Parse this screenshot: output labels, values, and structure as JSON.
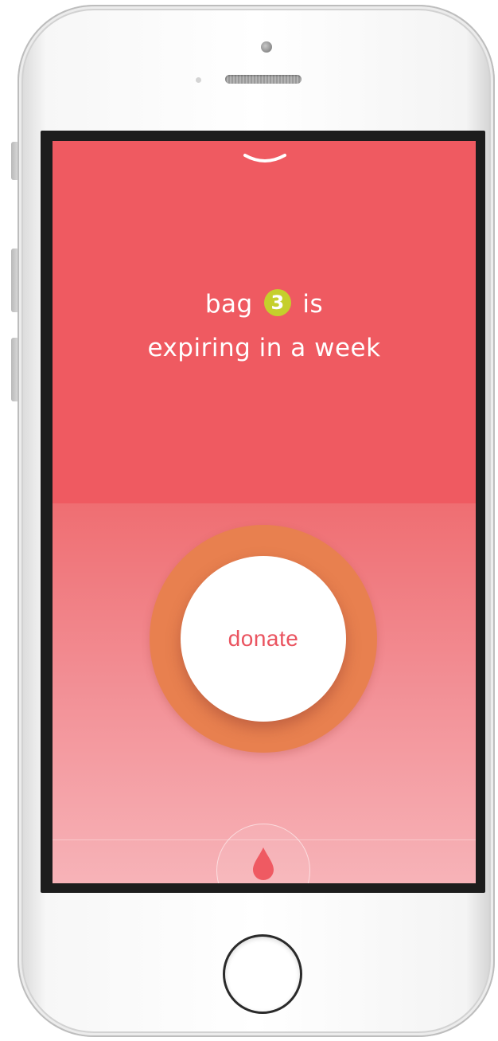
{
  "message": {
    "prefix": "bag",
    "bag_number": "3",
    "suffix": "is",
    "line2": "expiring in a week"
  },
  "action": {
    "donate_label": "donate"
  },
  "icons": {
    "collapse": "chevron-down-icon",
    "tab": "blood-drop-icon"
  },
  "colors": {
    "top_panel": "#ef5a61",
    "bottom_gradient_start": "#ef6e72",
    "bottom_gradient_end": "#f7b3b8",
    "badge": "#c5cf2c",
    "ring": "#e8804f",
    "donate_text": "#ea5460",
    "drop": "#ef5a62"
  }
}
